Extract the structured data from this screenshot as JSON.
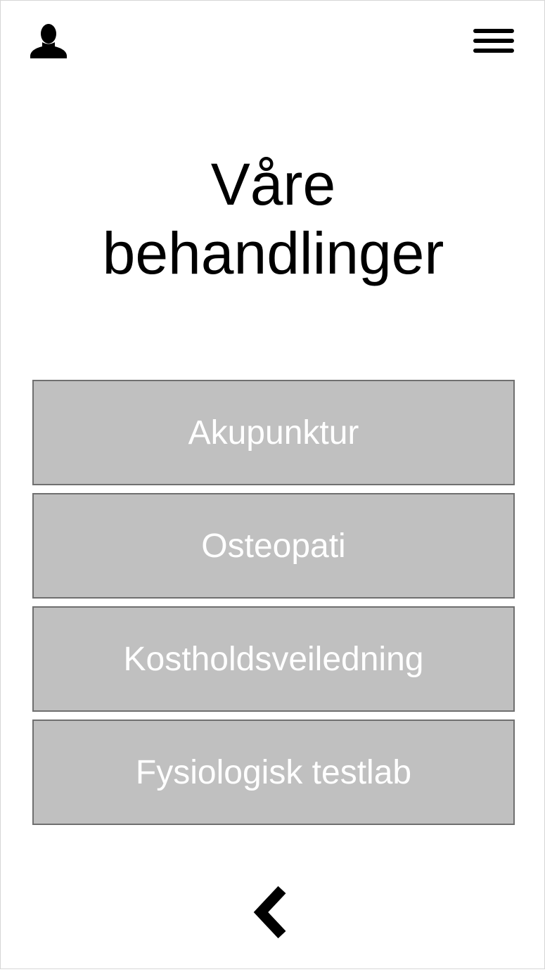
{
  "header": {
    "user_icon": "user-icon",
    "menu_icon": "hamburger-menu-icon"
  },
  "page": {
    "title_line1": "Våre",
    "title_line2": "behandlinger"
  },
  "treatments": [
    {
      "label": "Akupunktur"
    },
    {
      "label": "Osteopati"
    },
    {
      "label": "Kostholdsveiledning"
    },
    {
      "label": "Fysiologisk testlab"
    }
  ],
  "footer": {
    "back_icon": "chevron-left-icon"
  },
  "colors": {
    "button_fill": "#c0c0c0",
    "button_border": "#6f6f6f",
    "button_text": "#ffffff",
    "icon": "#000000"
  }
}
